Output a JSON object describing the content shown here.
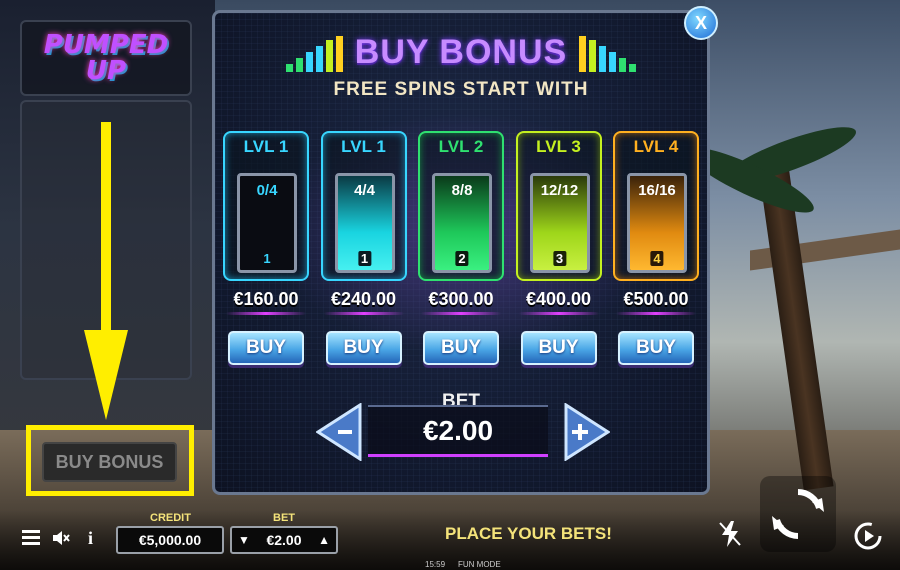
{
  "game": {
    "logo_text": "PUMPED UP",
    "left_buy_label": "BUY BONUS"
  },
  "panel": {
    "title": "BUY BONUS",
    "subtitle": "FREE SPINS START WITH",
    "close_label": "X",
    "levels": [
      {
        "label": "LVL 1",
        "count": "0/4",
        "number": "1",
        "price": "€160.00",
        "buy": "BUY",
        "fill": 0.0,
        "color": "#38d6ff",
        "fill_color": "#1ab8e0"
      },
      {
        "label": "LVL 1",
        "count": "4/4",
        "number": "1",
        "price": "€240.00",
        "buy": "BUY",
        "fill": 1.0,
        "color": "#38d6ff",
        "fill_color": "#19d4e0"
      },
      {
        "label": "LVL 2",
        "count": "8/8",
        "number": "2",
        "price": "€300.00",
        "buy": "BUY",
        "fill": 1.0,
        "color": "#2fe070",
        "fill_color": "#1ec85a"
      },
      {
        "label": "LVL 3",
        "count": "12/12",
        "number": "3",
        "price": "€400.00",
        "buy": "BUY",
        "fill": 1.0,
        "color": "#c4f020",
        "fill_color": "#9ed61a"
      },
      {
        "label": "LVL 4",
        "count": "16/16",
        "number": "4",
        "price": "€500.00",
        "buy": "BUY",
        "fill": 1.0,
        "color": "#ffb020",
        "fill_color": "#e08a10"
      }
    ],
    "bet_label": "BET",
    "bet_value": "€2.00"
  },
  "bottom": {
    "credit_label": "CREDIT",
    "credit_value": "€5,000.00",
    "bet_label": "BET",
    "bet_value": "€2.00",
    "status": "PLACE YOUR BETS!",
    "time": "15:59",
    "mode": "FUN MODE"
  },
  "colors": {
    "highlight": "#ffee00",
    "title": "#c78bff",
    "gold_text": "#f4e37a"
  },
  "icons": [
    "menu-icon",
    "sound-muted-icon",
    "info-icon",
    "turbo-off-icon",
    "spin-icon",
    "autoplay-icon",
    "close-icon",
    "arrow-down-icon",
    "minus-arrow-icon",
    "plus-arrow-icon"
  ]
}
